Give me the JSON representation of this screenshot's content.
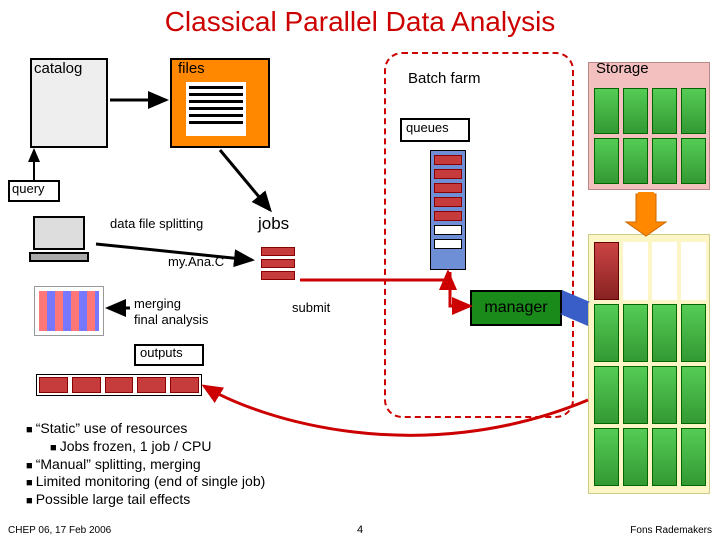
{
  "title": "Classical Parallel Data Analysis",
  "labels": {
    "catalog": "catalog",
    "files": "files",
    "batch_farm": "Batch farm",
    "storage": "Storage",
    "queues": "queues",
    "query": "query",
    "data_file_splitting": "data file splitting",
    "jobs": "jobs",
    "myana": "my.Ana.C",
    "merging1": "merging",
    "merging2": "final analysis",
    "submit": "submit",
    "manager": "manager",
    "outputs": "outputs"
  },
  "bullets": {
    "b1": "“Static” use of resources",
    "b1a": "Jobs frozen, 1 job / CPU",
    "b2": "“Manual” splitting, merging",
    "b3": "Limited monitoring (end of single job)",
    "b4": "Possible large tail effects"
  },
  "footer": {
    "left": "CHEP 06, 17 Feb 2006",
    "page": "4",
    "right": "Fons Rademakers"
  },
  "colors": {
    "title": "#cc0000",
    "files_fill": "#ff8800",
    "storage_fill": "#f4bfbf",
    "compute_fill": "#fcf6c6",
    "queue_band": "#6e8fd6",
    "manager": "#1a8a1a",
    "arrow_red": "#cc0000",
    "arrow_orange": "#ff8800",
    "arrow_blue": "#3a5ec8",
    "arrow_black": "#000"
  },
  "chart_data": {
    "type": "table",
    "title": "Classical Parallel Data Analysis",
    "nodes": [
      {
        "id": "catalog",
        "label": "catalog"
      },
      {
        "id": "files",
        "label": "files"
      },
      {
        "id": "batch_farm",
        "label": "Batch farm"
      },
      {
        "id": "storage",
        "label": "Storage"
      },
      {
        "id": "queues",
        "label": "queues"
      },
      {
        "id": "query",
        "label": "query"
      },
      {
        "id": "client",
        "label": "client workstation"
      },
      {
        "id": "jobs",
        "label": "jobs"
      },
      {
        "id": "manager",
        "label": "manager"
      },
      {
        "id": "outputs",
        "label": "outputs"
      },
      {
        "id": "compute_nodes",
        "label": "compute nodes"
      }
    ],
    "edges": [
      {
        "from": "query",
        "to": "catalog",
        "label": ""
      },
      {
        "from": "catalog",
        "to": "files",
        "label": ""
      },
      {
        "from": "files",
        "to": "jobs",
        "label": "data file splitting"
      },
      {
        "from": "client",
        "to": "jobs",
        "label": "my.Ana.C"
      },
      {
        "from": "jobs",
        "to": "queues",
        "label": "submit"
      },
      {
        "from": "queues",
        "to": "manager",
        "label": ""
      },
      {
        "from": "manager",
        "to": "compute_nodes",
        "label": ""
      },
      {
        "from": "compute_nodes",
        "to": "storage",
        "label": ""
      },
      {
        "from": "compute_nodes",
        "to": "outputs",
        "label": ""
      },
      {
        "from": "outputs",
        "to": "client",
        "label": "merging / final analysis"
      }
    ]
  }
}
